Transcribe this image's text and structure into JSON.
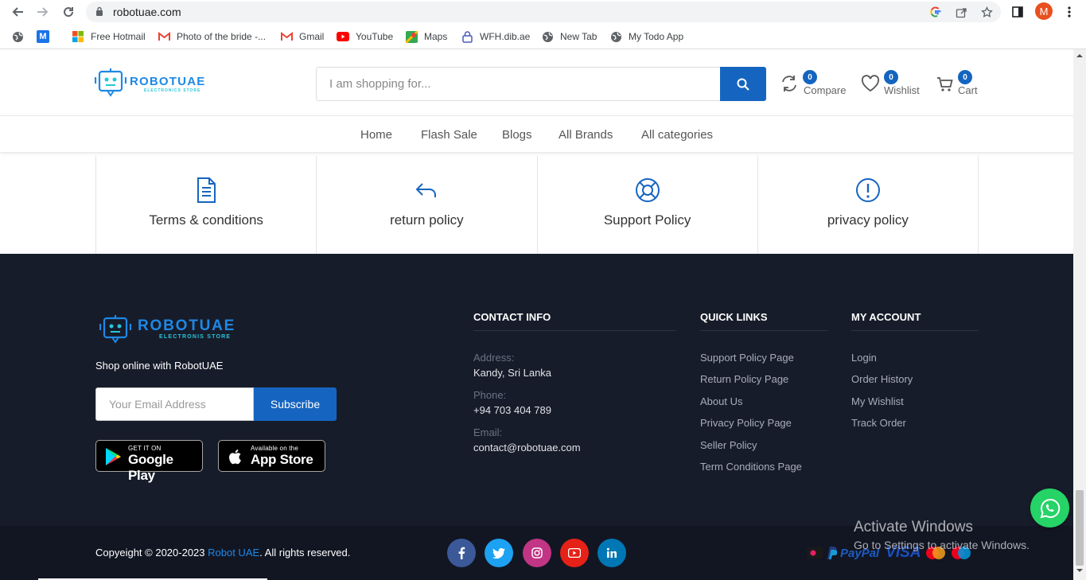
{
  "browser": {
    "url": "robotuae.com",
    "profile_initial": "M",
    "bookmarks": [
      {
        "label": ""
      },
      {
        "label": ""
      },
      {
        "label": "Free Hotmail"
      },
      {
        "label": "Photo of the bride -..."
      },
      {
        "label": "Gmail"
      },
      {
        "label": "YouTube"
      },
      {
        "label": "Maps"
      },
      {
        "label": "WFH.dib.ae"
      },
      {
        "label": "New Tab"
      },
      {
        "label": "My Todo App"
      }
    ]
  },
  "header": {
    "logo_text": "ROBOTUAE",
    "logo_sub": "ELECTRONICS STORE",
    "search_placeholder": "I am shopping for...",
    "compare": {
      "label": "Compare",
      "count": "0"
    },
    "wishlist": {
      "label": "Wishlist",
      "count": "0"
    },
    "cart": {
      "label": "Cart",
      "count": "0"
    }
  },
  "nav": [
    "Home",
    "Flash Sale",
    "Blogs",
    "All Brands",
    "All categories"
  ],
  "policies": [
    "Terms & conditions",
    "return policy",
    "Support Policy",
    "privacy policy"
  ],
  "footer": {
    "logo_text": "ROBOTUAE",
    "logo_sub": "ELECTRONIS STORE",
    "tagline": "Shop online with RobotUAE",
    "email_placeholder": "Your Email Address",
    "subscribe_label": "Subscribe",
    "google_play": {
      "small": "GET IT ON",
      "big": "Google Play"
    },
    "app_store": {
      "small": "Available on the",
      "big": "App Store"
    },
    "contact": {
      "title": "CONTACT INFO",
      "address_label": "Address:",
      "address": "Kandy, Sri Lanka",
      "phone_label": "Phone:",
      "phone": "+94 703 404 789",
      "email_label": "Email:",
      "email": "contact@robotuae.com"
    },
    "quick_links": {
      "title": "QUICK LINKS",
      "items": [
        "Support Policy Page",
        "Return Policy Page",
        "About Us",
        "Privacy Policy Page",
        "Seller Policy",
        "Term Conditions Page"
      ]
    },
    "my_account": {
      "title": "MY ACCOUNT",
      "items": [
        "Login",
        "Order History",
        "My Wishlist",
        "Track Order"
      ]
    },
    "copyright_prefix": "Copyeight © 2020-2023 ",
    "copyright_brand": "Robot UAE",
    "copyright_suffix": ". All rights reserved.",
    "social": [
      {
        "icon": "facebook-icon",
        "glyph": "f",
        "color": "#3b5998"
      },
      {
        "icon": "twitter-icon",
        "glyph": "t",
        "color": "#1da1f2"
      },
      {
        "icon": "instagram-icon",
        "glyph": "◎",
        "color": "#c13584"
      },
      {
        "icon": "youtube-icon",
        "glyph": "▶",
        "color": "#e62117"
      },
      {
        "icon": "linkedin-icon",
        "glyph": "in",
        "color": "#0077b5"
      }
    ],
    "payments": {
      "paypal": "PayPal",
      "visa": "VISA"
    }
  },
  "watermark": {
    "line1": "Activate Windows",
    "line2": "Go to Settings to activate Windows."
  },
  "colors": {
    "brand_blue": "#1565c0",
    "footer_bg": "#171c2a",
    "whatsapp": "#25d366"
  }
}
